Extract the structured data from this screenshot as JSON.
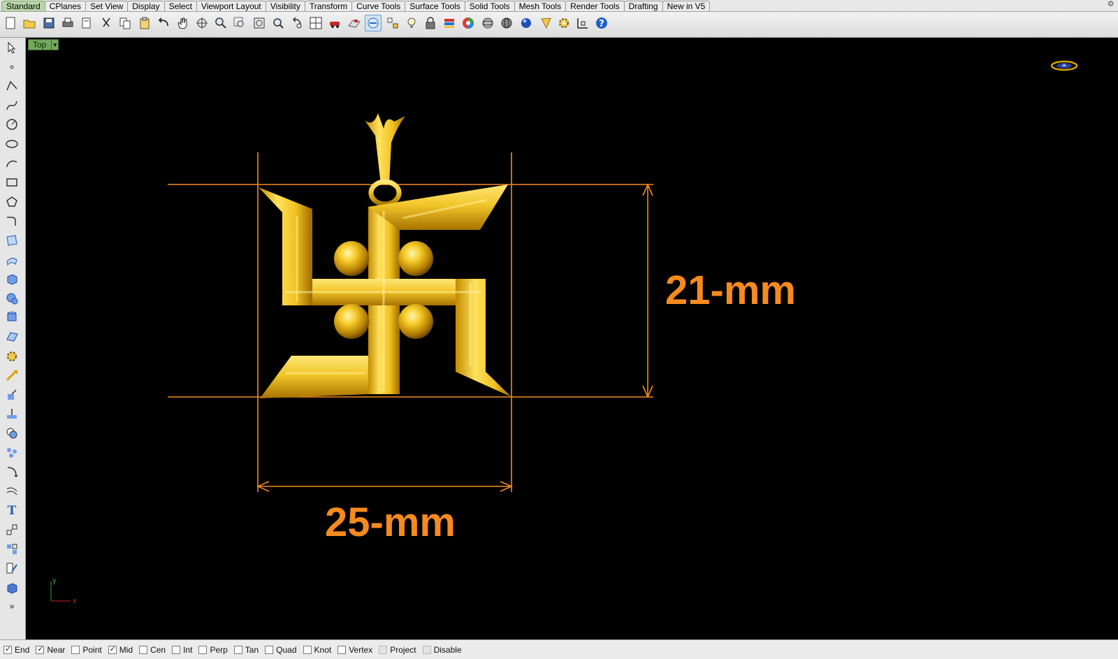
{
  "tabs": [
    "Standard",
    "CPlanes",
    "Set View",
    "Display",
    "Select",
    "Viewport Layout",
    "Visibility",
    "Transform",
    "Curve Tools",
    "Surface Tools",
    "Solid Tools",
    "Mesh Tools",
    "Render Tools",
    "Drafting",
    "New in V5"
  ],
  "active_tab": "Standard",
  "viewport": {
    "label": "Top",
    "dimension_height": "21-mm",
    "dimension_width": "25-mm",
    "axis_x": "x",
    "axis_y": "y"
  },
  "osnaps": [
    {
      "label": "End",
      "checked": true
    },
    {
      "label": "Near",
      "checked": true
    },
    {
      "label": "Point",
      "checked": false
    },
    {
      "label": "Mid",
      "checked": true
    },
    {
      "label": "Cen",
      "checked": false
    },
    {
      "label": "Int",
      "checked": false
    },
    {
      "label": "Perp",
      "checked": false
    },
    {
      "label": "Tan",
      "checked": false
    },
    {
      "label": "Quad",
      "checked": false
    },
    {
      "label": "Knot",
      "checked": false
    },
    {
      "label": "Vertex",
      "checked": false
    },
    {
      "label": "Project",
      "checked": false,
      "disabled": true
    },
    {
      "label": "Disable",
      "checked": false,
      "disabled": true
    }
  ],
  "colors": {
    "dimension": "#f58a1f",
    "gold_light": "#ffe06a",
    "gold_dark": "#b07a00",
    "viewport_bg": "#000000",
    "active_tab": "#b9d7a8"
  }
}
